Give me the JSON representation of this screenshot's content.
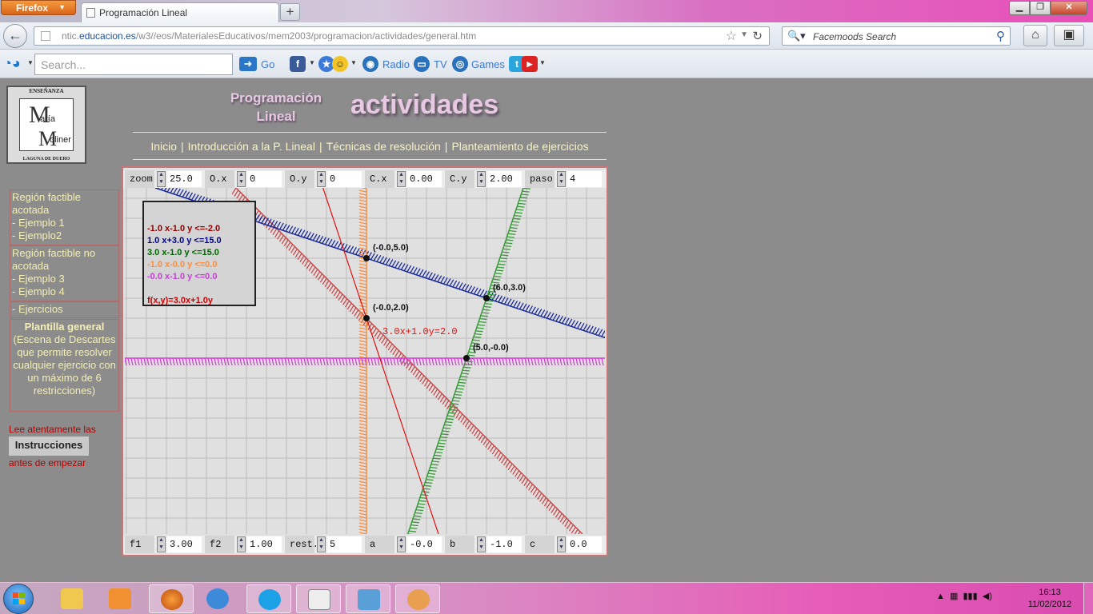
{
  "browser": {
    "menu_label": "Firefox",
    "tab_title": "Programación Lineal",
    "url_prefix": "ntic.",
    "url_domain": "educacion.es",
    "url_path": "/w3//eos/MaterialesEducativos/mem2003/programacion/actividades/general.htm",
    "search_engine_text": "Facemoods Search"
  },
  "toolbar": {
    "search_placeholder": "Search...",
    "go_label": "Go",
    "radio_label": "Radio",
    "tv_label": "TV",
    "games_label": "Games"
  },
  "header": {
    "title_line1": "Programación",
    "title_line2": "Lineal",
    "section": "actividades"
  },
  "nav": {
    "items": [
      "Inicio",
      "Introducción a la P. Lineal",
      "Técnicas de resolución",
      "Planteamiento de ejercicios"
    ]
  },
  "logo": {
    "ring_top": "ENSEÑANZA",
    "ring_bottom": "LAGUNA DE DUERO",
    "aria": "aría",
    "oliner": "oliner"
  },
  "sidebar": {
    "group1": {
      "title_line1": "Región factible",
      "title_line2": "acotada",
      "items": [
        "- Ejemplo 1",
        "- Ejemplo2"
      ]
    },
    "group2": {
      "title_line1": "Región factible no",
      "title_line2": "acotada",
      "items": [
        "- Ejemplo 3",
        "- Ejemplo 4"
      ]
    },
    "exercises": "- Ejercicios",
    "template_title": "Plantilla general",
    "template_desc": "(Escena de Descartes que permite resolver cualquier ejercicio con un máximo de 6 restricciones)",
    "lee": "Lee atentamente las",
    "instructions_button": "Instrucciones",
    "antes": "antes de empezar"
  },
  "controls_top": [
    {
      "label": "zoom",
      "value": "25.0"
    },
    {
      "label": "O.x",
      "value": "0"
    },
    {
      "label": "O.y",
      "value": "0"
    },
    {
      "label": "C.x",
      "value": "0.00"
    },
    {
      "label": "C.y",
      "value": "2.00"
    },
    {
      "label": "paso",
      "value": "4"
    }
  ],
  "controls_bottom": [
    {
      "label": "f1",
      "value": "3.00"
    },
    {
      "label": "f2",
      "value": "1.00"
    },
    {
      "label": "rest.",
      "value": "5"
    },
    {
      "label": "a",
      "value": "-0.0"
    },
    {
      "label": "b",
      "value": "-1.0"
    },
    {
      "label": "c",
      "value": "0.0"
    }
  ],
  "legend": {
    "constraints": [
      {
        "text": "-1.0 x-1.0 y <=-2.0",
        "color": "#8b0000"
      },
      {
        "text": "1.0 x+3.0 y <=15.0",
        "color": "#00008b"
      },
      {
        "text": "3.0 x-1.0 y <=15.0",
        "color": "#006400"
      },
      {
        "text": "-1.0 x-0.0 y <=0.0",
        "color": "#ff8c3a"
      },
      {
        "text": "-0.0 x-1.0 y <=0.0",
        "color": "#c040d0"
      }
    ],
    "objective": {
      "text": "f(x,y)=3.0x+1.0y",
      "color": "#d00000"
    }
  },
  "plot": {
    "scale": 25,
    "origin": {
      "x": 0,
      "y": 0
    },
    "level_line_label": "3.0x+1.0y=2.0",
    "vertices": [
      {
        "x": 0,
        "y": 5,
        "label": "(-0.0,5.0)"
      },
      {
        "x": 6,
        "y": 3,
        "label": "(6.0,3.0)"
      },
      {
        "x": 0,
        "y": 2,
        "label": "(-0.0,2.0)"
      },
      {
        "x": 5,
        "y": 0,
        "label": "(5.0,-0.0)"
      }
    ],
    "lines": [
      {
        "a": -1,
        "b": -1,
        "c": -2,
        "color": "#c84a4a"
      },
      {
        "a": 1,
        "b": 3,
        "c": 15,
        "color": "#1a2a9a"
      },
      {
        "a": 3,
        "b": -1,
        "c": 15,
        "color": "#3a9a3a"
      },
      {
        "a": -1,
        "b": 0,
        "c": 0,
        "color": "#ff8c3a"
      },
      {
        "a": 0,
        "b": -1,
        "c": 0,
        "color": "#d040d0"
      }
    ],
    "objective_line": {
      "a": 3,
      "b": 1,
      "c": 2,
      "color": "#e01010"
    }
  },
  "taskbar": {
    "time": "16:13",
    "date": "11/02/2012"
  }
}
